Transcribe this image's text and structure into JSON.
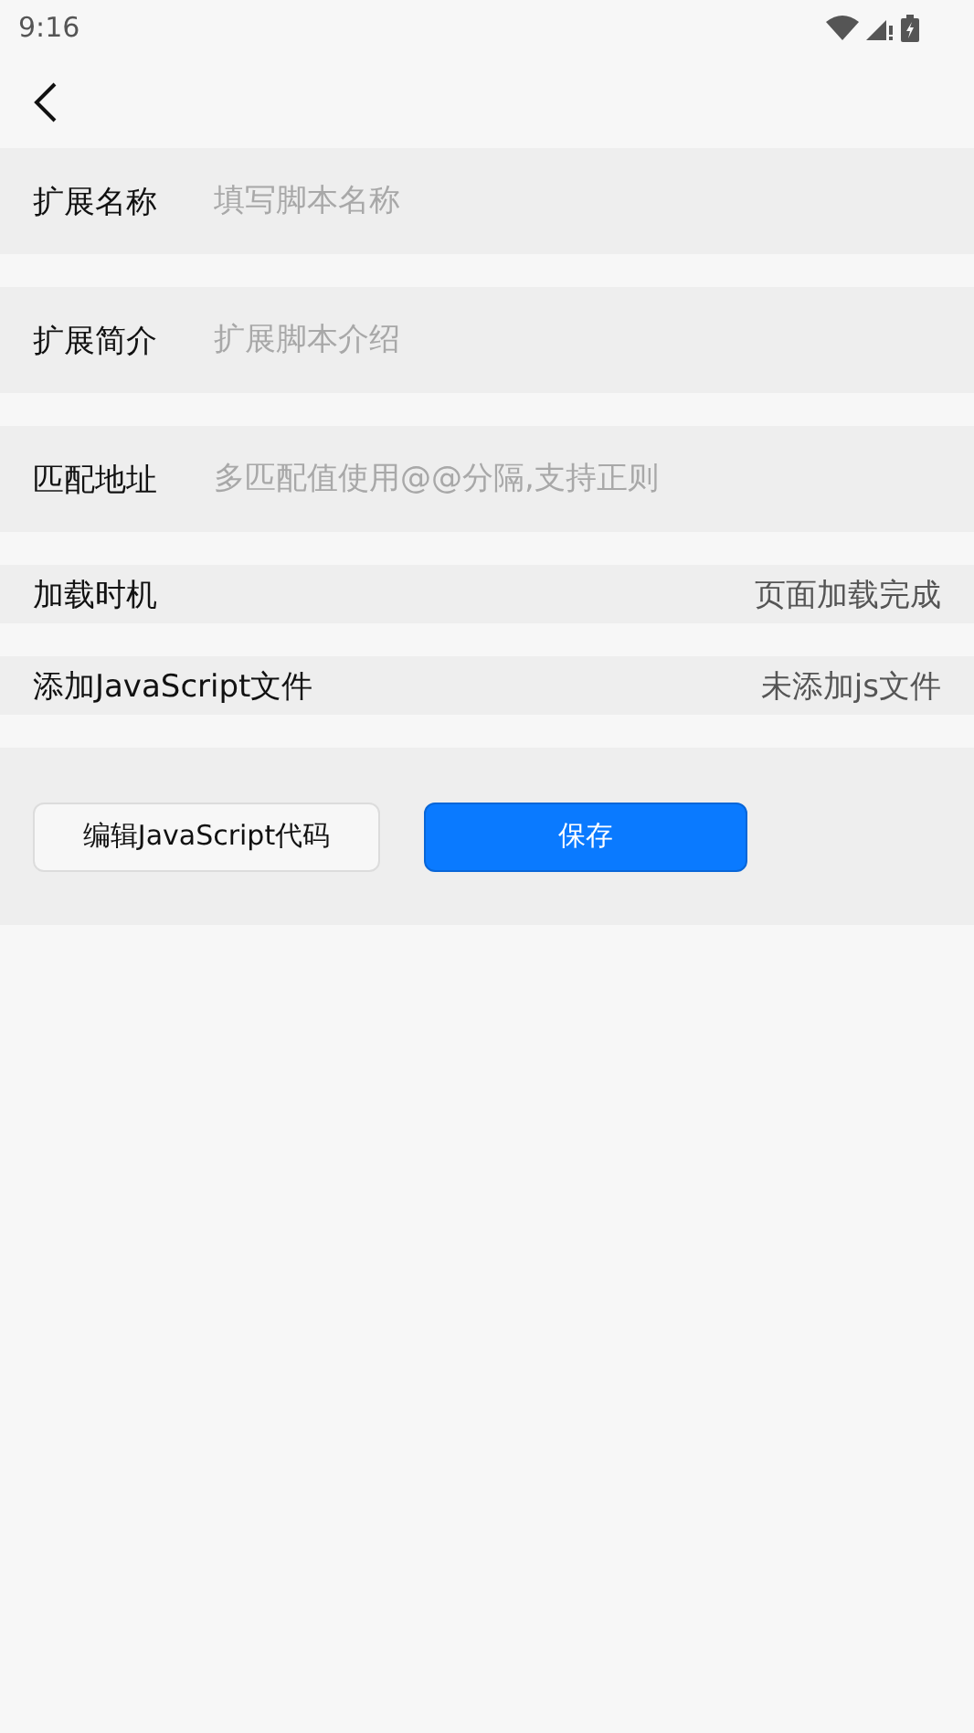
{
  "status_bar": {
    "time": "9:16"
  },
  "fields": [
    {
      "label": "扩展名称",
      "placeholder": "填写脚本名称"
    },
    {
      "label": "扩展简介",
      "placeholder": "扩展脚本介绍"
    },
    {
      "label": "匹配地址",
      "placeholder": "多匹配值使用@@分隔,支持正则"
    }
  ],
  "settings": [
    {
      "label": "加载时机",
      "value": "页面加载完成"
    },
    {
      "label": "添加JavaScript文件",
      "value": "未添加js文件"
    }
  ],
  "buttons": [
    {
      "label": "编辑JavaScript代码",
      "kind": "secondary"
    },
    {
      "label": "保存",
      "kind": "primary"
    }
  ]
}
